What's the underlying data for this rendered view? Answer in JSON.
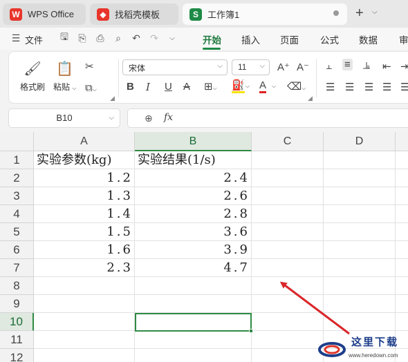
{
  "tabs": [
    {
      "label": "WPS Office",
      "icon": "wps-logo-icon",
      "color": "#e8352b"
    },
    {
      "label": "找稻壳模板",
      "icon": "docer-logo-icon",
      "color": "#e8352b"
    },
    {
      "label": "工作簿1",
      "icon": "spreadsheet-icon",
      "color": "#1e8a46",
      "icon_letter": "S",
      "active": true
    }
  ],
  "new_tab": "+",
  "menubar": {
    "file_label": "文件",
    "tabs": [
      "开始",
      "插入",
      "页面",
      "公式",
      "数据",
      "审"
    ],
    "active_tab": "开始"
  },
  "ribbon": {
    "format_painter": "格式刷",
    "paste": "粘贴",
    "font_name": "宋体",
    "font_size": "11"
  },
  "formula_bar": {
    "name_box": "B10",
    "fx": "fx",
    "value": ""
  },
  "sheet": {
    "columns": [
      "A",
      "B",
      "C",
      "D"
    ],
    "selected_column": "B",
    "rows": [
      "1",
      "2",
      "3",
      "4",
      "5",
      "6",
      "7",
      "8",
      "9",
      "10",
      "11",
      "12"
    ],
    "selected_row": "10",
    "headers": [
      "实验参数(kg)",
      "实验结果(1/s)"
    ],
    "data": [
      [
        "1.2",
        "2.4"
      ],
      [
        "1.3",
        "2.6"
      ],
      [
        "1.4",
        "2.8"
      ],
      [
        "1.5",
        "3.6"
      ],
      [
        "1.6",
        "3.9"
      ],
      [
        "2.3",
        "4.7"
      ]
    ],
    "selected_cell": "B10"
  },
  "watermark": {
    "title": "这里下载",
    "url": "www.heredown.com"
  },
  "colors": {
    "accent": "#1e8a46",
    "arrow": "#d9262a"
  }
}
